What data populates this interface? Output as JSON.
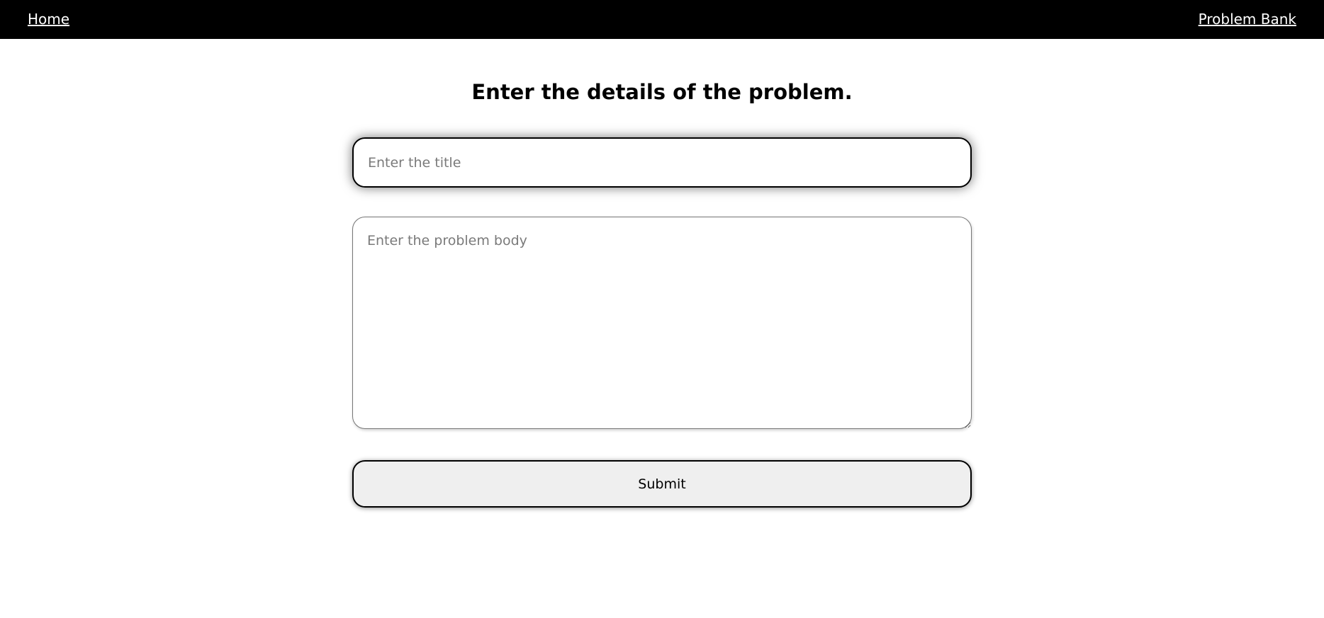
{
  "nav": {
    "home_label": "Home",
    "problem_bank_label": "Problem Bank"
  },
  "main": {
    "heading": "Enter the details of the problem.",
    "title_input": {
      "value": "",
      "placeholder": "Enter the title"
    },
    "body_textarea": {
      "value": "",
      "placeholder": "Enter the problem body"
    },
    "submit_label": "Submit"
  },
  "colors": {
    "navbar_bg": "#000000",
    "nav_text": "#ffffff",
    "button_bg": "#efefef"
  }
}
